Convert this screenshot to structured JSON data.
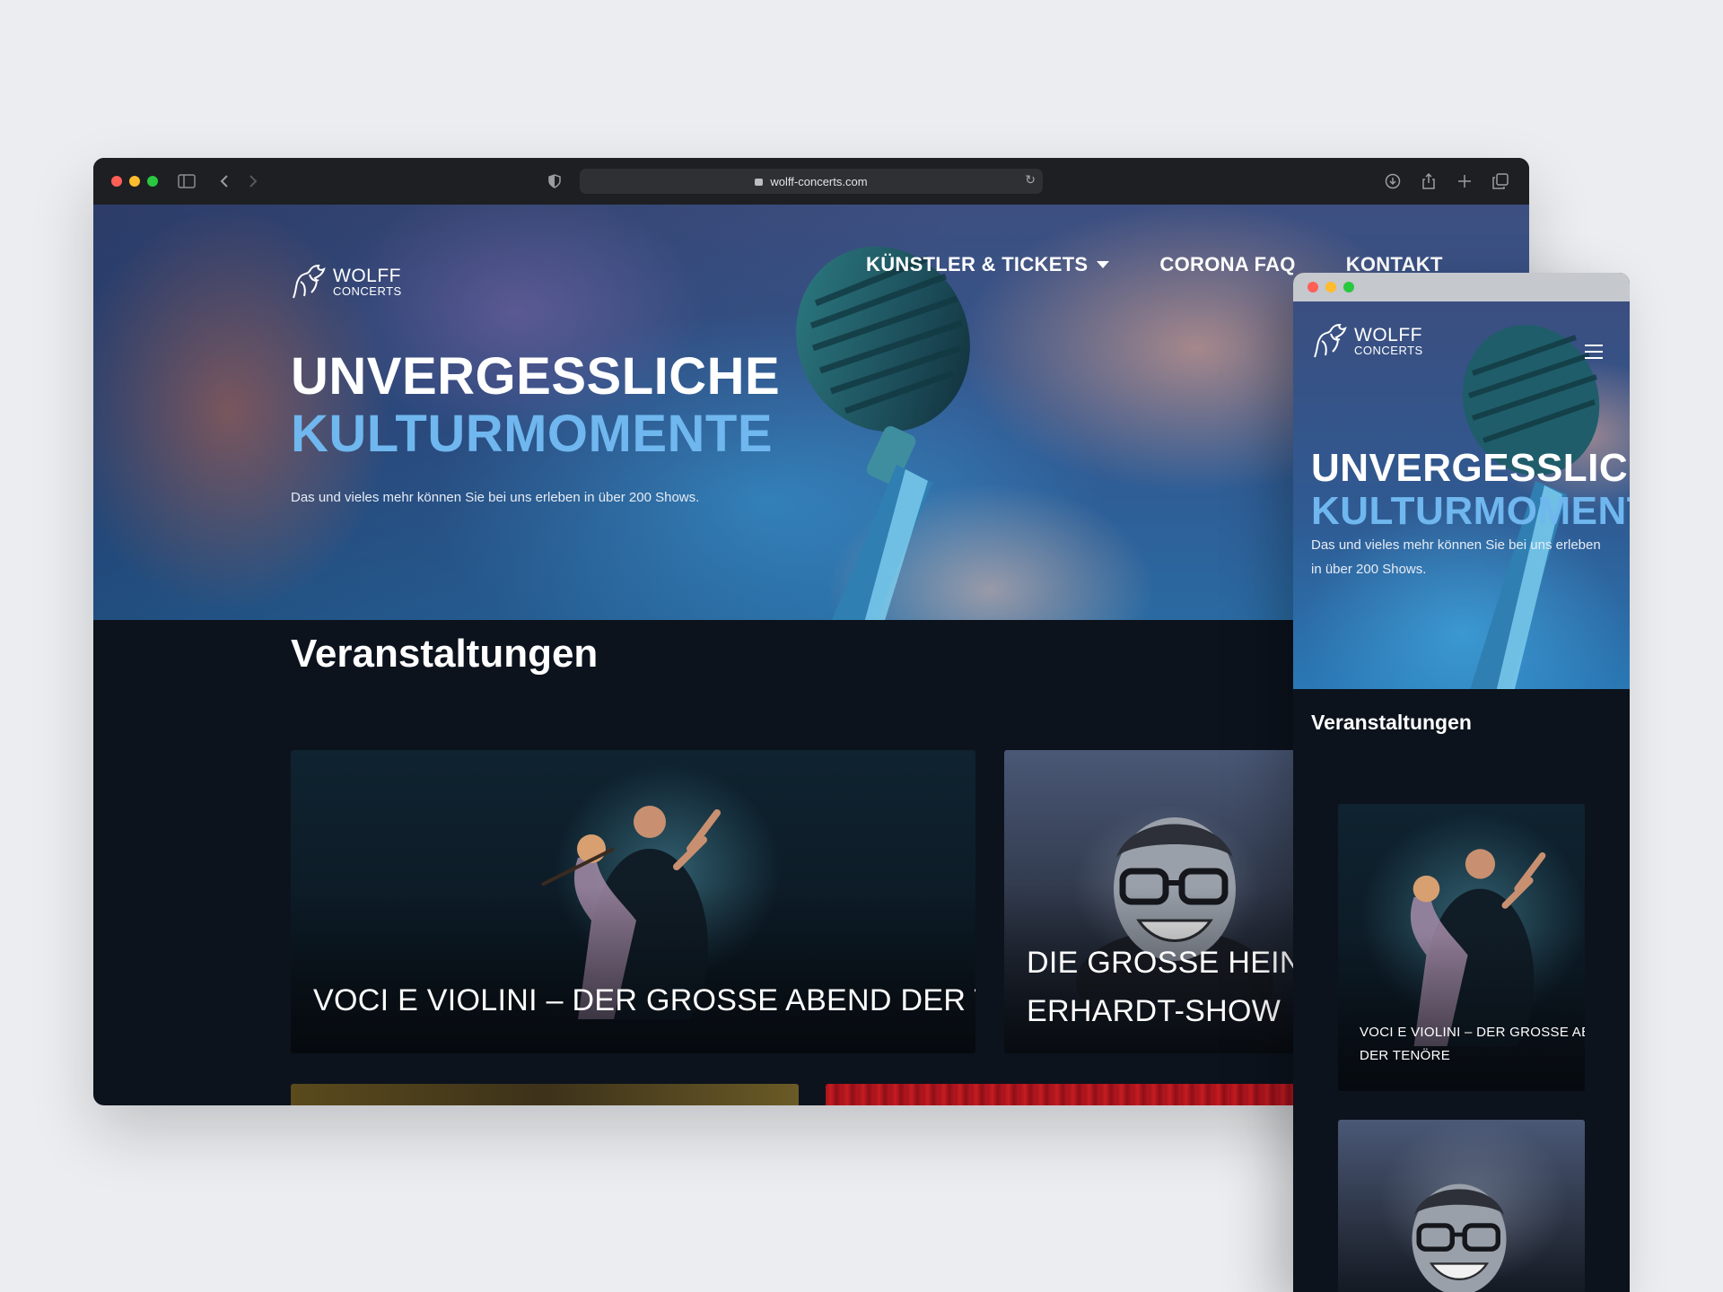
{
  "browser": {
    "url": "wolff-concerts.com",
    "lights": [
      "#ff5f57",
      "#febc2e",
      "#28c840"
    ]
  },
  "brand": {
    "line1": "WOLFF",
    "line2": "CONCERTS"
  },
  "nav": {
    "items": [
      "KÜNSTLER & TICKETS",
      "CORONA FAQ",
      "KONTAKT"
    ]
  },
  "hero": {
    "title_line1": "UNVERGESSLICHE",
    "title_line2": "KULTURMOMENTE",
    "subtitle": "Das und vieles mehr können Sie bei uns erleben in über 200 Shows.",
    "accent": "#6fb7ee"
  },
  "events": {
    "heading": "Veranstaltungen",
    "cards": [
      {
        "title": "VOCI E VIOLINI – DER GROSSE ABEND DER TENÖRE"
      },
      {
        "title_line1": "DIE GROSSE HEINZ",
        "title_line2": "ERHARDT-SHOW"
      }
    ]
  },
  "mobile": {
    "subtitle_line1": "Das und vieles mehr können Sie bei uns erleben",
    "subtitle_line2": "in über 200 Shows.",
    "card1_line1": "VOCI E VIOLINI – DER GROSSE ABEND",
    "card1_line2": "DER TENÖRE",
    "menu_icon": "hamburger-icon"
  }
}
